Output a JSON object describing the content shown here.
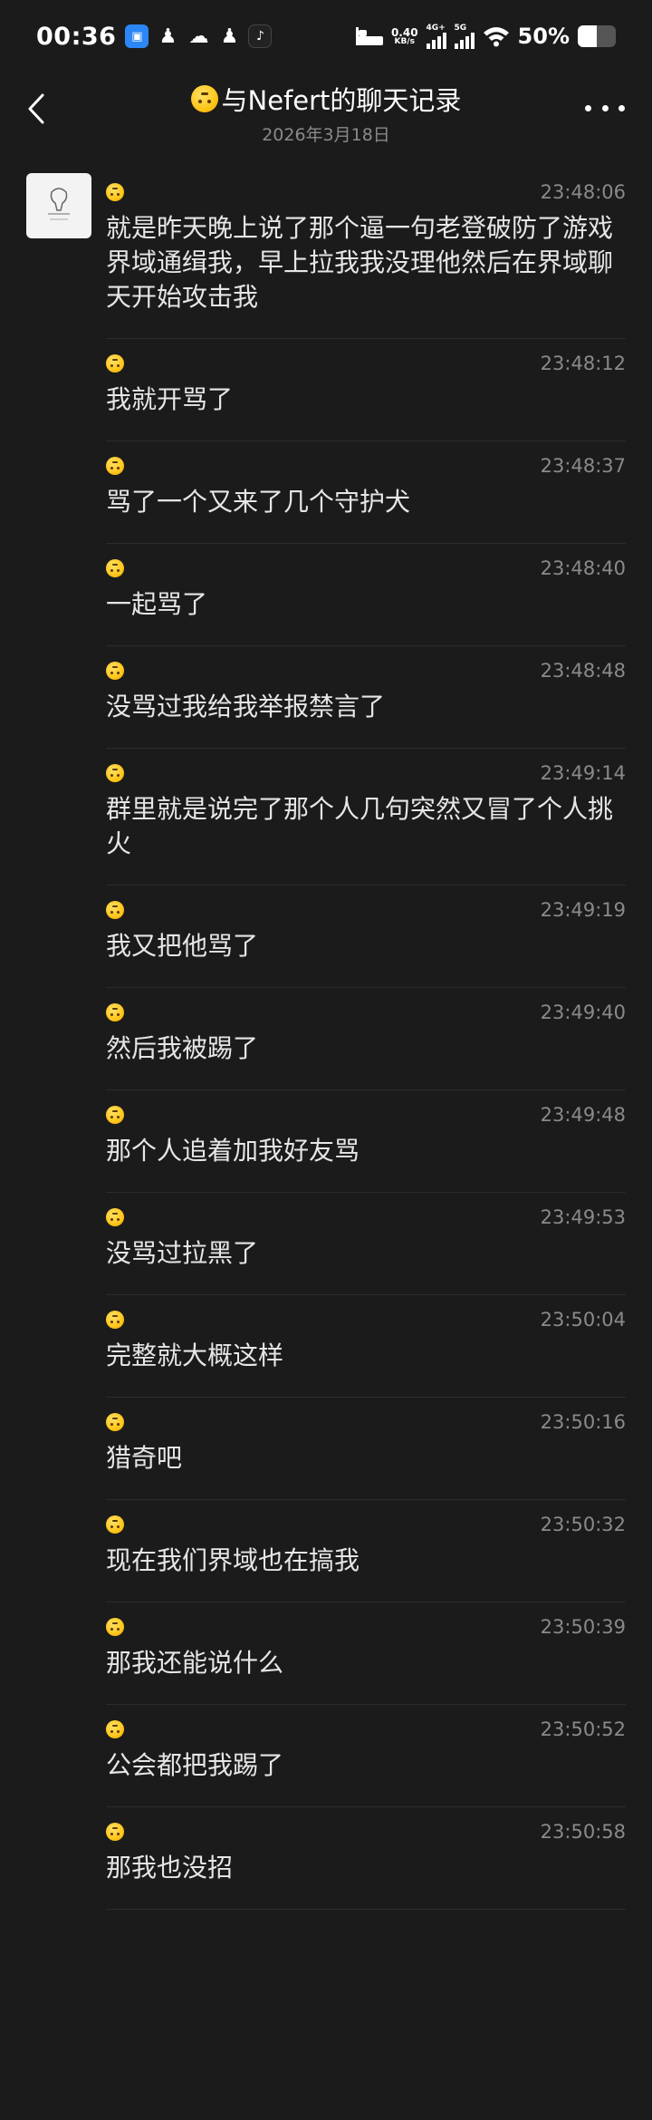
{
  "status_bar": {
    "time": "00:36",
    "net_speed_value": "0.40",
    "net_speed_unit": "KB/s",
    "sim1_label": "4G+",
    "sim2_label": "5G",
    "battery_percent": "50%",
    "battery_level": 0.5,
    "app_icons": [
      "chat-app-icon",
      "qq-icon",
      "wechat-icon",
      "qq-icon",
      "tiktok-icon"
    ]
  },
  "header": {
    "title": "与Nefert的聊天记录",
    "date": "2026年3月18日"
  },
  "messages": [
    {
      "time": "23:48:06",
      "text": "就是昨天晚上说了那个逼一句老登破防了游戏界域通缉我，早上拉我我没理他然后在界域聊天开始攻击我"
    },
    {
      "time": "23:48:12",
      "text": "我就开骂了"
    },
    {
      "time": "23:48:37",
      "text": "骂了一个又来了几个守护犬"
    },
    {
      "time": "23:48:40",
      "text": "一起骂了"
    },
    {
      "time": "23:48:48",
      "text": "没骂过我给我举报禁言了"
    },
    {
      "time": "23:49:14",
      "text": "群里就是说完了那个人几句突然又冒了个人挑火"
    },
    {
      "time": "23:49:19",
      "text": "我又把他骂了"
    },
    {
      "time": "23:49:40",
      "text": "然后我被踢了"
    },
    {
      "time": "23:49:48",
      "text": "那个人追着加我好友骂"
    },
    {
      "time": "23:49:53",
      "text": "没骂过拉黑了"
    },
    {
      "time": "23:50:04",
      "text": "完整就大概这样"
    },
    {
      "time": "23:50:16",
      "text": "猎奇吧"
    },
    {
      "time": "23:50:32",
      "text": "现在我们界域也在搞我"
    },
    {
      "time": "23:50:39",
      "text": "那我还能说什么"
    },
    {
      "time": "23:50:52",
      "text": "公会都把我踢了"
    },
    {
      "time": "23:50:58",
      "text": "那我也没招"
    }
  ]
}
